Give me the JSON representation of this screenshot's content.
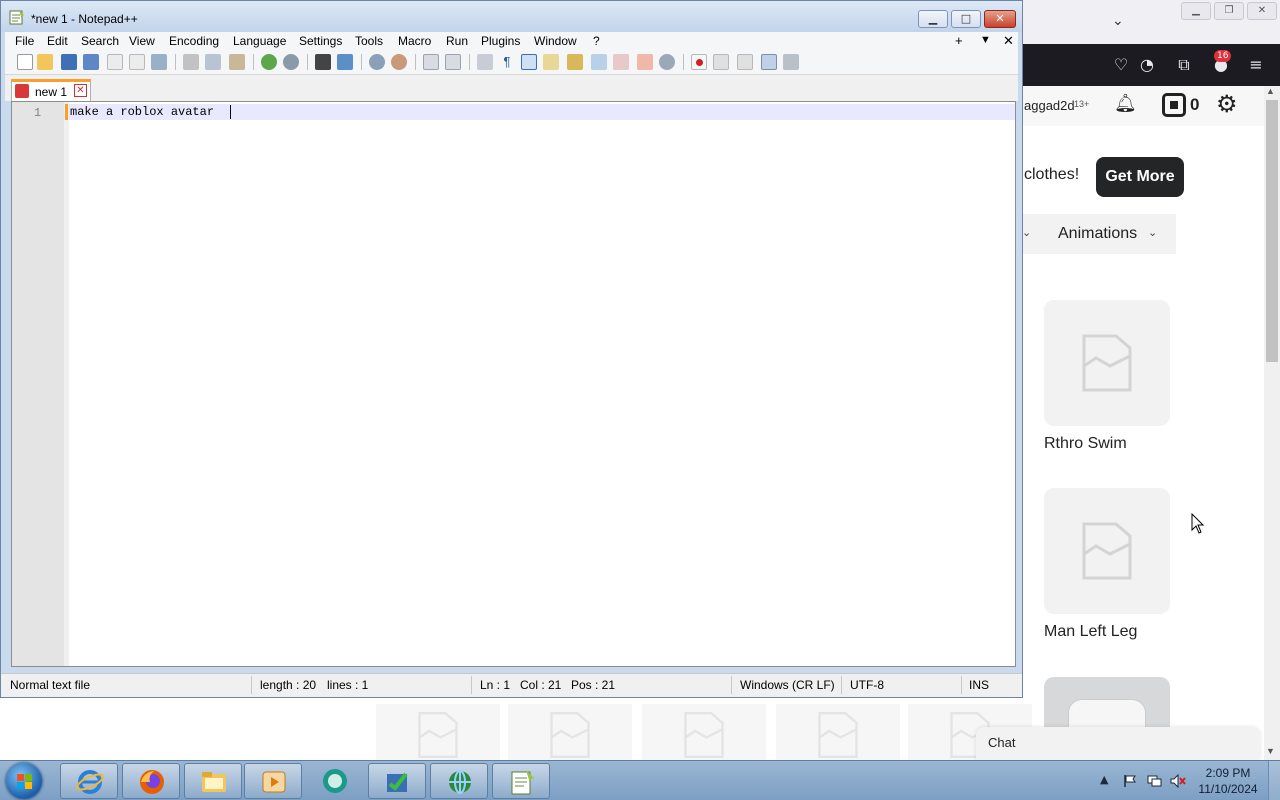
{
  "browser": {
    "username": "aggad2d",
    "age_tag": "13+",
    "robux_count": "0",
    "extension_badge": "16",
    "promo_text": "clothes!",
    "get_more_label": "Get More",
    "animations_tab": "Animations",
    "items": [
      {
        "name": "Rthro Swim"
      },
      {
        "name": "Man Left Leg"
      }
    ],
    "chat_label": "Chat"
  },
  "notepad": {
    "window_title": "*new 1 - Notepad++",
    "menu": [
      "File",
      "Edit",
      "Search",
      "View",
      "Encoding",
      "Language",
      "Settings",
      "Tools",
      "Macro",
      "Run",
      "Plugins",
      "Window",
      "?"
    ],
    "menu_plus": "+",
    "menu_dropdown": "▼",
    "menu_close": "✕",
    "tab_label": "new 1",
    "line_number": "1",
    "content": "make a roblox avatar",
    "status": {
      "file_type": "Normal text file",
      "length": "length : 20",
      "lines": "lines : 1",
      "ln": "Ln : 1",
      "col": "Col : 21",
      "pos": "Pos : 21",
      "eol": "Windows (CR LF)",
      "encoding": "UTF-8",
      "mode": "INS"
    }
  },
  "taskbar": {
    "time": "2:09 PM",
    "date": "11/10/2024",
    "apps": [
      "internet-explorer-icon",
      "firefox-icon",
      "file-explorer-icon",
      "media-player-icon",
      "teamviewer-icon",
      "task-manager-icon",
      "network-browser-icon",
      "notepad-plus-plus-icon"
    ]
  },
  "colors": {
    "accent_tab": "#fa9f2a",
    "current_line": "#e8e8ff",
    "button_dark": "#232527"
  }
}
